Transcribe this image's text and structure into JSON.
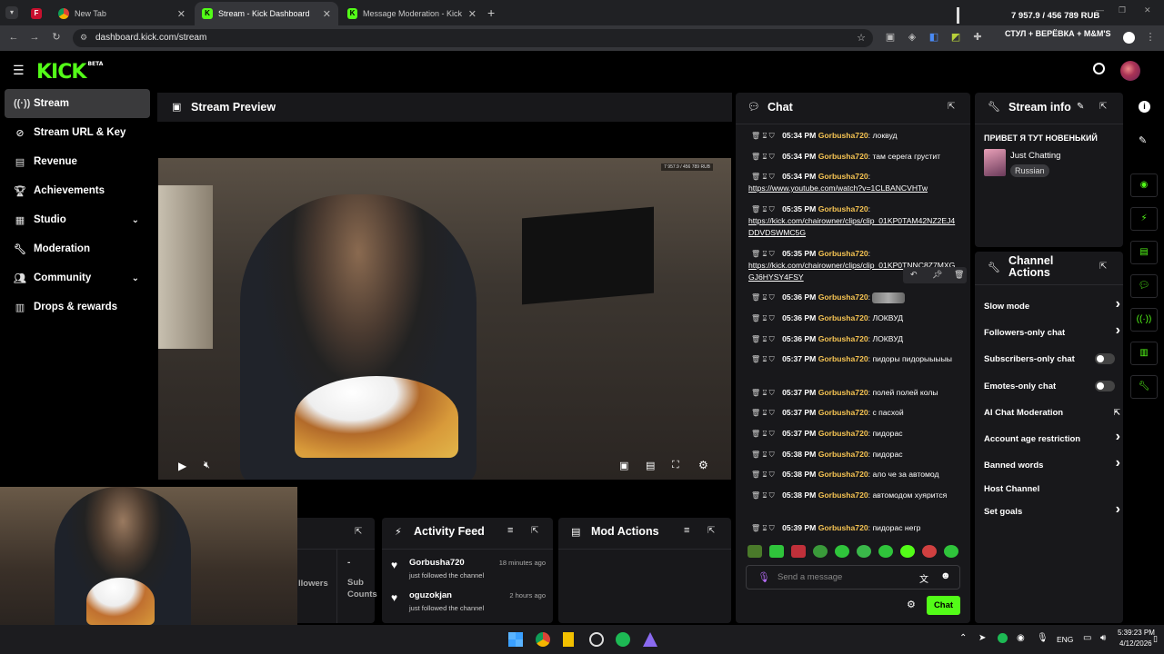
{
  "browser": {
    "tabs": [
      {
        "label": "New Tab",
        "favicon": "chrome-icon"
      },
      {
        "label": "Stream - Kick Dashboard",
        "favicon": "kick-icon"
      },
      {
        "label": "Message Moderation - Kick Da",
        "favicon": "kick-icon"
      }
    ],
    "first_tab_letter": "F",
    "url": "dashboard.kick.com/stream",
    "overlay_top": "7 957.9 / 456 789 RUB",
    "overlay_sub": "СТУЛ + ВЕРЁВКА + M&M'S"
  },
  "logo": {
    "text": "KICK",
    "tag": "BETA"
  },
  "sidebar": {
    "items": [
      {
        "label": "Stream",
        "icon": "broadcast-icon",
        "active": true
      },
      {
        "label": "Stream URL & Key",
        "icon": "link-icon"
      },
      {
        "label": "Revenue",
        "icon": "chart-icon"
      },
      {
        "label": "Achievements",
        "icon": "trophy-icon"
      },
      {
        "label": "Studio",
        "icon": "studio-icon",
        "expand": true
      },
      {
        "label": "Moderation",
        "icon": "wrench-icon"
      },
      {
        "label": "Community",
        "icon": "people-icon",
        "expand": true
      },
      {
        "label": "Drops & rewards",
        "icon": "gift-icon"
      }
    ]
  },
  "preview": {
    "title": "Stream Preview",
    "video_overlay": "7 957.9 / 456 789 RUB"
  },
  "stats": {
    "label_partial": "llowers",
    "dash": "-",
    "sub_label": "Sub Counts"
  },
  "activity": {
    "title": "Activity Feed",
    "items": [
      {
        "user": "Gorbusha720",
        "time": "18 minutes ago",
        "text": "just followed the channel"
      },
      {
        "user": "oguzokjan",
        "time": "2 hours ago",
        "text": "just followed the channel"
      }
    ]
  },
  "mod_actions": {
    "title": "Mod Actions"
  },
  "chat": {
    "title": "Chat",
    "messages": [
      {
        "time": "05:34 PM",
        "user": "Gorbusha720",
        "text": "локвуд"
      },
      {
        "time": "05:34 PM",
        "user": "Gorbusha720",
        "text": "там серега грустит"
      },
      {
        "time": "05:34 PM",
        "user": "Gorbusha720",
        "text": "https://www.youtube.com/watch?v=1CLBANCVHTw"
      },
      {
        "time": "05:35 PM",
        "user": "Gorbusha720",
        "text": "https://kick.com/chairowner/clips/clip_01KP0TAM42NZ2EJ4DDVDSWMC5G"
      },
      {
        "time": "05:35 PM",
        "user": "Gorbusha720",
        "text": "https://kick.com/chairowner/clips/clip_01KP0TNNC8Z7MXGGJ6HYSY4FSY"
      },
      {
        "time": "05:36 PM",
        "user": "Gorbusha720",
        "text": ""
      },
      {
        "time": "05:36 PM",
        "user": "Gorbusha720",
        "text": "ЛОКВУД"
      },
      {
        "time": "05:36 PM",
        "user": "Gorbusha720",
        "text": "ЛОКВУД"
      },
      {
        "time": "05:37 PM",
        "user": "Gorbusha720",
        "text": "пидоры пидорыыыыы"
      },
      {
        "time": "05:37 PM",
        "user": "Gorbusha720",
        "text": "полей полей колы"
      },
      {
        "time": "05:37 PM",
        "user": "Gorbusha720",
        "text": "с пасхой"
      },
      {
        "time": "05:37 PM",
        "user": "Gorbusha720",
        "text": "пидорас"
      },
      {
        "time": "05:38 PM",
        "user": "Gorbusha720",
        "text": "пидорас"
      },
      {
        "time": "05:38 PM",
        "user": "Gorbusha720",
        "text": "ало че за автомод"
      },
      {
        "time": "05:38 PM",
        "user": "Gorbusha720",
        "text": "автомодом хуярится"
      },
      {
        "time": "05:39 PM",
        "user": "Gorbusha720",
        "text": "пидорас негр"
      }
    ],
    "input_placeholder": "Send a message",
    "send_label": "Chat"
  },
  "stream_info": {
    "title": "Stream info",
    "stream_title": "ПРИВЕТ Я ТУТ НОВЕНЬКИЙ",
    "category": "Just Chatting",
    "language": "Russian"
  },
  "channel_actions": {
    "title": "Channel Actions",
    "items": [
      {
        "label": "Slow mode",
        "kind": "arrow"
      },
      {
        "label": "Followers-only chat",
        "kind": "arrow"
      },
      {
        "label": "Subscribers-only chat",
        "kind": "toggle"
      },
      {
        "label": "Emotes-only chat",
        "kind": "toggle"
      },
      {
        "label": "AI Chat Moderation",
        "kind": "external"
      },
      {
        "label": "Account age restriction",
        "kind": "arrow"
      },
      {
        "label": "Banned words",
        "kind": "arrow"
      },
      {
        "label": "Host Channel",
        "kind": "none"
      },
      {
        "label": "Set goals",
        "kind": "arrow"
      }
    ]
  },
  "taskbar": {
    "lang": "ENG",
    "time": "5:39:23 PM",
    "date": "4/12/2026"
  },
  "colors": {
    "accent": "#53fc18",
    "username": "#f6c453",
    "panel": "#18181b"
  }
}
